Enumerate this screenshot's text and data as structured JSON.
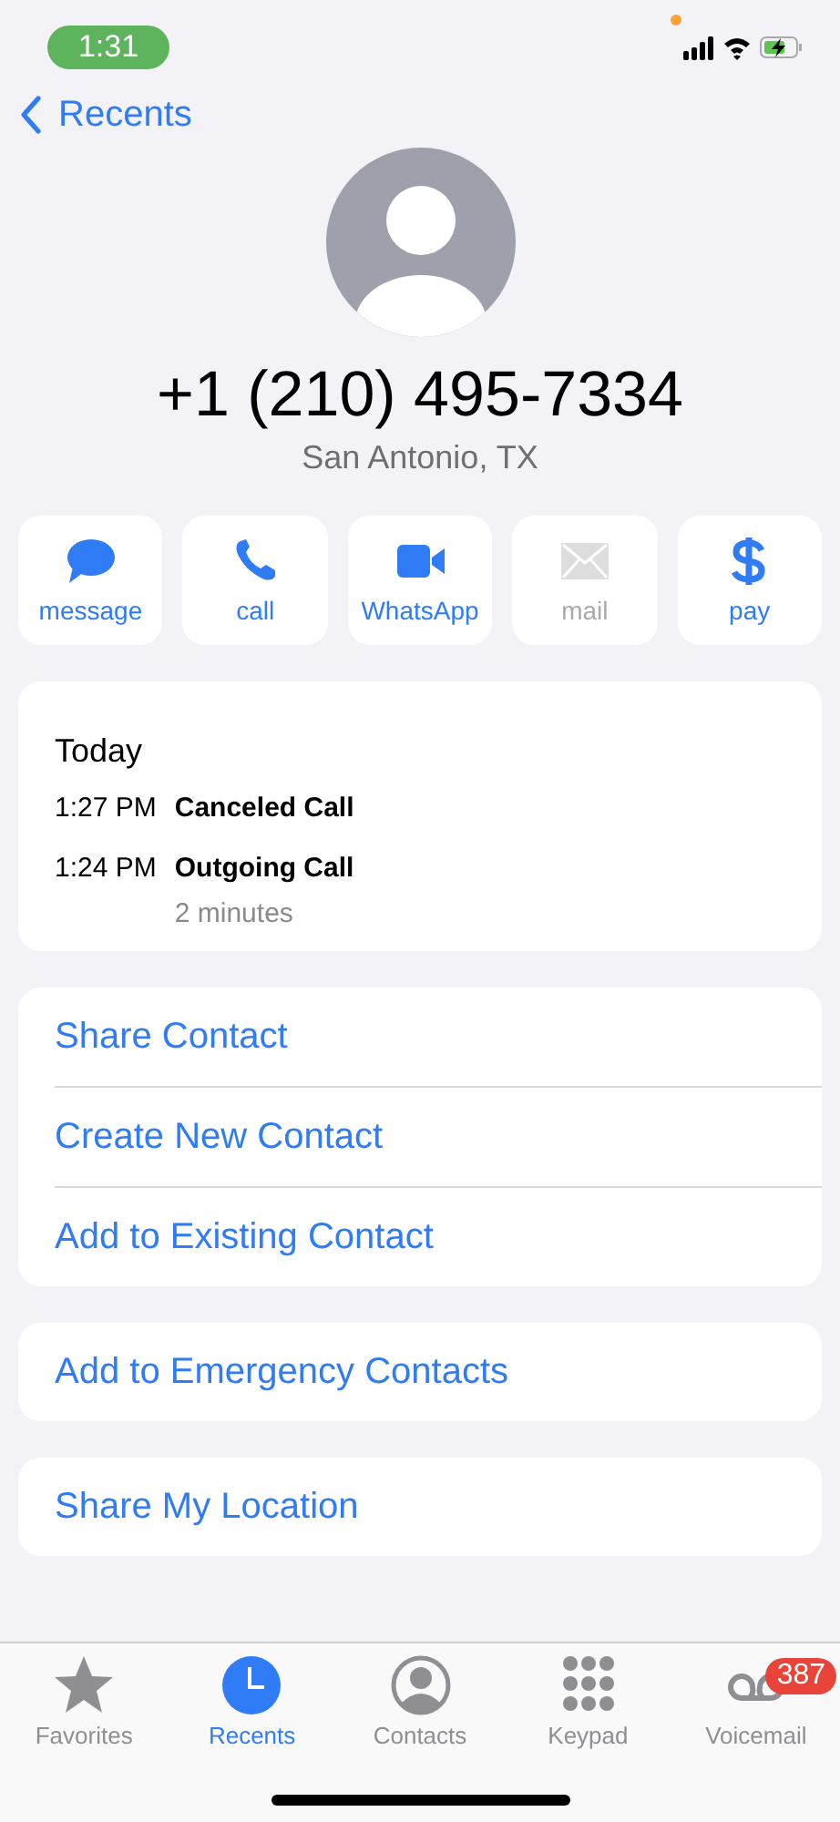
{
  "status_bar": {
    "time": "1:31"
  },
  "nav": {
    "back_label": "Recents"
  },
  "contact": {
    "number": "+1 (210) 495-7334",
    "location": "San Antonio, TX"
  },
  "actions": [
    {
      "kind": "message",
      "label": "message",
      "disabled": false
    },
    {
      "kind": "call",
      "label": "call",
      "disabled": false
    },
    {
      "kind": "video",
      "label": "WhatsApp",
      "disabled": false
    },
    {
      "kind": "mail",
      "label": "mail",
      "disabled": true
    },
    {
      "kind": "pay",
      "label": "pay",
      "disabled": false
    }
  ],
  "call_log": {
    "heading": "Today",
    "entries": [
      {
        "time": "1:27 PM",
        "type": "Canceled Call"
      },
      {
        "time": "1:24 PM",
        "type": "Outgoing Call",
        "duration": "2 minutes"
      }
    ]
  },
  "link_groups": [
    [
      "Share Contact",
      "Create New Contact",
      "Add to Existing Contact"
    ],
    [
      "Add to Emergency Contacts"
    ],
    [
      "Share My Location"
    ]
  ],
  "tab_bar": [
    {
      "kind": "star",
      "label": "Favorites",
      "selected": false
    },
    {
      "kind": "clock",
      "label": "Recents",
      "selected": true
    },
    {
      "kind": "person",
      "label": "Contacts",
      "selected": false
    },
    {
      "kind": "keypad",
      "label": "Keypad",
      "selected": false
    },
    {
      "kind": "voicemail",
      "label": "Voicemail",
      "selected": false,
      "badge": "387"
    }
  ]
}
